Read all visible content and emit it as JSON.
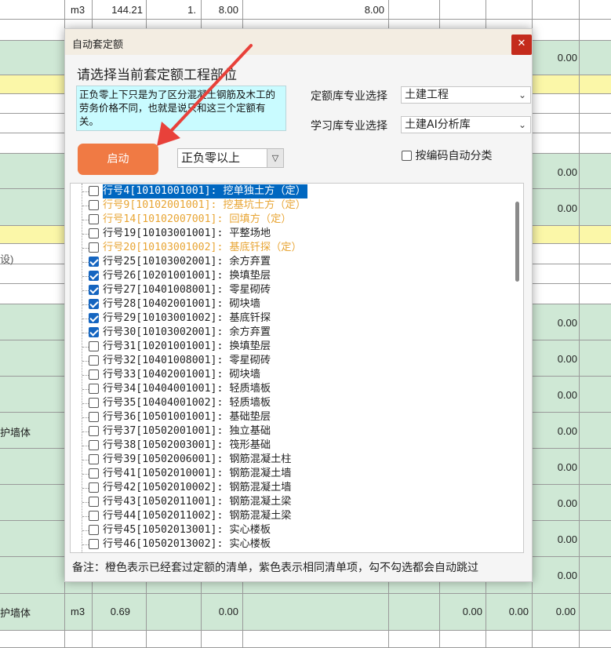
{
  "sheet": {
    "cells": [
      {
        "text": "m3",
        "col": "unit",
        "row": 0
      },
      {
        "text": "144.21",
        "col": "qty",
        "row": 0
      },
      {
        "text": "1.",
        "col": "c3",
        "row": 0
      },
      {
        "text": "8.00",
        "col": "c4",
        "row": 0
      },
      {
        "text": "8.00",
        "col": "c6",
        "row": 0
      }
    ],
    "right_values": [
      "0.00",
      "0.00",
      "0.00",
      "0.00",
      "0.00",
      "0.00",
      "0.00",
      "0.00",
      "0.00",
      "0.00",
      "0.00",
      "0.00",
      "0.00",
      "0.00"
    ],
    "left_partial_text": "护墙体",
    "left_partial_text2": "护墙体",
    "left_partial_paren": "设)",
    "bottom_row": {
      "unit": "m3",
      "qty": "0.69",
      "c4": "0.00",
      "c8": "0.00",
      "c9": "0.00",
      "c10": "0.00"
    }
  },
  "dialog": {
    "title": "自动套定额",
    "close_icon": "close-icon",
    "prompt": "请选择当前套定额工程部位",
    "memo": "正负零上下只是为了区分混凝土钢筋及木工的劳务价格不同，也就是说只和这三个定额有关。",
    "quota_label": "定额库专业选择",
    "quota_value": "土建工程",
    "learn_label": "学习库专业选择",
    "learn_value": "土建AI分析库",
    "start_label": "启动",
    "zero_value": "正负零以上",
    "auto_classify_label": "按编码自动分类",
    "note": "备注：橙色表示已经套过定额的清单，紫色表示相同清单项，勾不勾选都会自动跳过",
    "accent_color": "#f07a44",
    "orange_color": "#e8a534"
  },
  "items": [
    {
      "label": "行号4[10101001001]: 挖单独土方（定）",
      "checked": false,
      "style": "selected"
    },
    {
      "label": "行号9[10102001001]: 挖基坑土方（定）",
      "checked": false,
      "style": "orange"
    },
    {
      "label": "行号14[10102007001]: 回填方（定）",
      "checked": false,
      "style": "orange"
    },
    {
      "label": "行号19[10103001001]: 平整场地",
      "checked": false,
      "style": "normal"
    },
    {
      "label": "行号20[10103001002]: 基底钎探（定）",
      "checked": false,
      "style": "orange"
    },
    {
      "label": "行号25[10103002001]: 余方弃置",
      "checked": true,
      "style": "normal"
    },
    {
      "label": "行号26[10201001001]: 换填垫层",
      "checked": true,
      "style": "normal"
    },
    {
      "label": "行号27[10401008001]: 零星砌砖",
      "checked": true,
      "style": "normal"
    },
    {
      "label": "行号28[10402001001]: 砌块墙",
      "checked": true,
      "style": "normal"
    },
    {
      "label": "行号29[10103001002]: 基底钎探",
      "checked": true,
      "style": "normal"
    },
    {
      "label": "行号30[10103002001]: 余方弃置",
      "checked": true,
      "style": "normal"
    },
    {
      "label": "行号31[10201001001]: 换填垫层",
      "checked": false,
      "style": "normal"
    },
    {
      "label": "行号32[10401008001]: 零星砌砖",
      "checked": false,
      "style": "normal"
    },
    {
      "label": "行号33[10402001001]: 砌块墙",
      "checked": false,
      "style": "normal"
    },
    {
      "label": "行号34[10404001001]: 轻质墙板",
      "checked": false,
      "style": "normal"
    },
    {
      "label": "行号35[10404001002]: 轻质墙板",
      "checked": false,
      "style": "normal"
    },
    {
      "label": "行号36[10501001001]: 基础垫层",
      "checked": false,
      "style": "normal"
    },
    {
      "label": "行号37[10502001001]: 独立基础",
      "checked": false,
      "style": "normal"
    },
    {
      "label": "行号38[10502003001]: 筏形基础",
      "checked": false,
      "style": "normal"
    },
    {
      "label": "行号39[10502006001]: 钢筋混凝土柱",
      "checked": false,
      "style": "normal"
    },
    {
      "label": "行号41[10502010001]: 钢筋混凝土墙",
      "checked": false,
      "style": "normal"
    },
    {
      "label": "行号42[10502010002]: 钢筋混凝土墙",
      "checked": false,
      "style": "normal"
    },
    {
      "label": "行号43[10502011001]: 钢筋混凝土梁",
      "checked": false,
      "style": "normal"
    },
    {
      "label": "行号44[10502011002]: 钢筋混凝土梁",
      "checked": false,
      "style": "normal"
    },
    {
      "label": "行号45[10502013001]: 实心楼板",
      "checked": false,
      "style": "normal"
    },
    {
      "label": "行号46[10502013002]: 实心楼板",
      "checked": false,
      "style": "normal"
    }
  ]
}
